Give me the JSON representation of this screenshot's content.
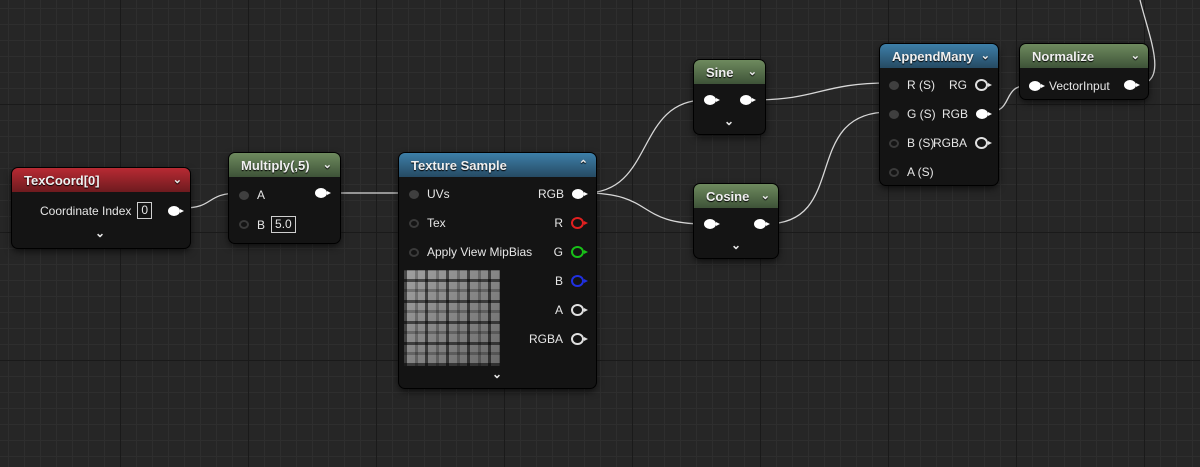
{
  "colors": {
    "wire": "#d8d8d8",
    "texcoord_header": "#b82a33",
    "math_header": "#5a7a4e",
    "texture_header": "#3d7fa8"
  },
  "texcoord": {
    "title": "TexCoord[0]",
    "coordinate_index_label": "Coordinate Index",
    "coordinate_index_value": "0"
  },
  "multiply": {
    "title": "Multiply(,5)",
    "input_a": "A",
    "input_b": "B",
    "b_value": "5.0"
  },
  "texture_sample": {
    "title": "Texture Sample",
    "inputs": [
      "UVs",
      "Tex",
      "Apply View MipBias"
    ],
    "outputs": [
      "RGB",
      "R",
      "G",
      "B",
      "A",
      "RGBA"
    ]
  },
  "sine": {
    "title": "Sine"
  },
  "cosine": {
    "title": "Cosine"
  },
  "append_many": {
    "title": "AppendMany",
    "inputs": [
      "R (S)",
      "G (S)",
      "B (S)",
      "A (S)"
    ],
    "outputs": [
      "RG",
      "RGB",
      "RGBA"
    ]
  },
  "normalize": {
    "title": "Normalize",
    "input": "VectorInput"
  },
  "icons": {
    "collapse": "chevron-down-icon",
    "expand": "chevron-up-icon"
  }
}
